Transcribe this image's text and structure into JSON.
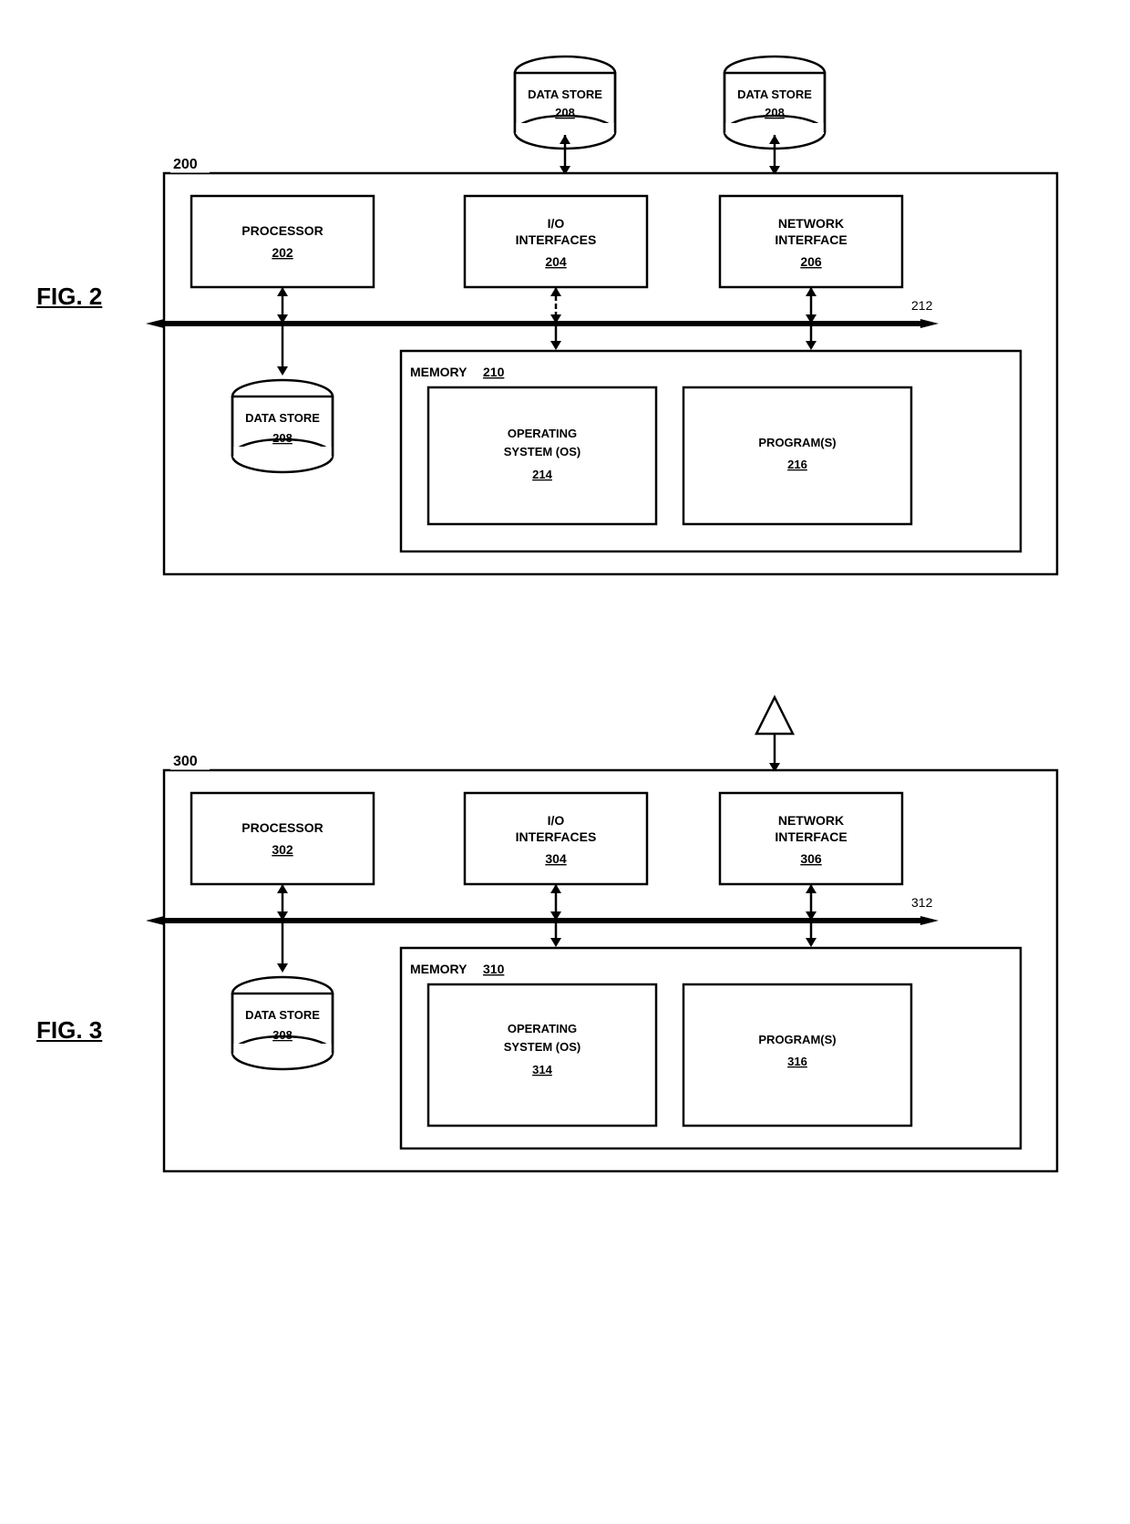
{
  "fig2": {
    "label": "FIG. 2",
    "box_id": "200",
    "bus_id": "212",
    "bus_label": "212",
    "top_datastores": [
      {
        "label": "DATA STORE",
        "num": "208"
      },
      {
        "label": "DATA STORE",
        "num": "208"
      }
    ],
    "processor": {
      "label": "PROCESSOR",
      "num": "202"
    },
    "io_interfaces": {
      "label": "I/O INTERFACES",
      "num": "204"
    },
    "network_interface": {
      "label": "NETWORK INTERFACE",
      "num": "206"
    },
    "datastore_bottom": {
      "label": "DATA STORE",
      "num": "208"
    },
    "memory": {
      "label": "MEMORY",
      "num": "210",
      "os": {
        "label": "OPERATING SYSTEM (OS)",
        "num": "214"
      },
      "programs": {
        "label": "PROGRAM(S)",
        "num": "216"
      }
    }
  },
  "fig3": {
    "label": "FIG. 3",
    "box_id": "300",
    "bus_id": "312",
    "bus_label": "312",
    "processor": {
      "label": "PROCESSOR",
      "num": "302"
    },
    "io_interfaces": {
      "label": "I/O INTERFACES",
      "num": "304"
    },
    "network_interface": {
      "label": "NETWORK INTERFACE",
      "num": "306"
    },
    "datastore_bottom": {
      "label": "DATA STORE",
      "num": "308"
    },
    "memory": {
      "label": "MEMORY",
      "num": "310",
      "os": {
        "label": "OPERATING SYSTEM (OS)",
        "num": "314"
      },
      "programs": {
        "label": "PROGRAM(S)",
        "num": "316"
      }
    }
  }
}
